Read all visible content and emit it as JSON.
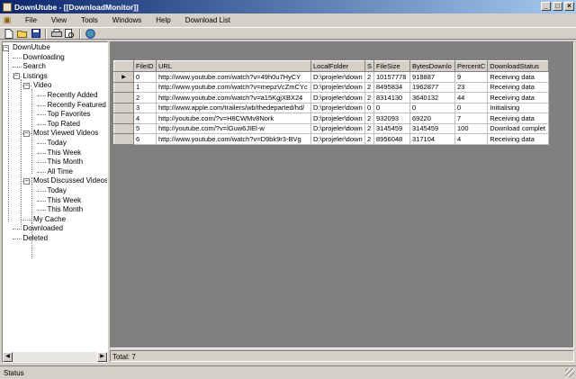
{
  "window": {
    "title": "DownUtube - [[DownloadMonitor]]"
  },
  "menu": [
    "File",
    "View",
    "Tools",
    "Windows",
    "Help",
    "Download List"
  ],
  "toolbar": [
    "new-icon",
    "open-icon",
    "save-icon",
    "print-icon",
    "print-preview-icon",
    "globe-icon"
  ],
  "tree": [
    "DownUtube",
    "Downloading",
    "Search",
    "Listings",
    "Video",
    "Recently Added",
    "Recently Featured",
    "Top Favorites",
    "Top Rated",
    "Most Viewed Videos",
    "Today",
    "This Week",
    "This Month",
    "All Time",
    "Most Discussed Videos",
    "Today",
    "This Week",
    "This Month",
    "My Cache",
    "Downloaded",
    "Deleted"
  ],
  "grid": {
    "columns": [
      "FileID",
      "URL",
      "LocalFolder",
      "S",
      "FileSize",
      "BytesDownlo",
      "PercentC",
      "DownloadStatus"
    ],
    "rows": [
      [
        "0",
        "http://www.youtube.com/watch?v=49h0u7HyCY",
        "D:\\projeler\\down",
        "2",
        "10157778",
        "918887",
        "9",
        "Receiving data"
      ],
      [
        "1",
        "http://www.youtube.com/watch?v=mepzVcZmCYc",
        "D:\\projeler\\down",
        "2",
        "8495834",
        "1962877",
        "23",
        "Receiving data"
      ],
      [
        "2",
        "http://www.youtube.com/watch?v=a15KgjXBX24",
        "D:\\projeler\\down",
        "2",
        "8314130",
        "3640132",
        "44",
        "Receiving data"
      ],
      [
        "3",
        "http://www.apple.com/trailers/wb/thedeparted/hd/",
        "D:\\projeler\\down",
        "0",
        "0",
        "0",
        "0",
        "Initialising"
      ],
      [
        "4",
        "http://youtube.com/?v=H8CWMv8Nork",
        "D:\\projeler\\down",
        "2",
        "932093",
        "69220",
        "7",
        "Receiving data"
      ],
      [
        "5",
        "http://youtube.com/?v=lGuw6JIEl-w",
        "D:\\projeler\\down",
        "2",
        "3145459",
        "3145459",
        "100",
        "Download complet"
      ],
      [
        "6",
        "http://www.youtube.com/watch?v=D9bk9r3-BVg",
        "D:\\projeler\\down",
        "2",
        "8956048",
        "317104",
        "4",
        "Receiving data"
      ]
    ]
  },
  "total_label": "Total: 7",
  "status_label": "Status"
}
